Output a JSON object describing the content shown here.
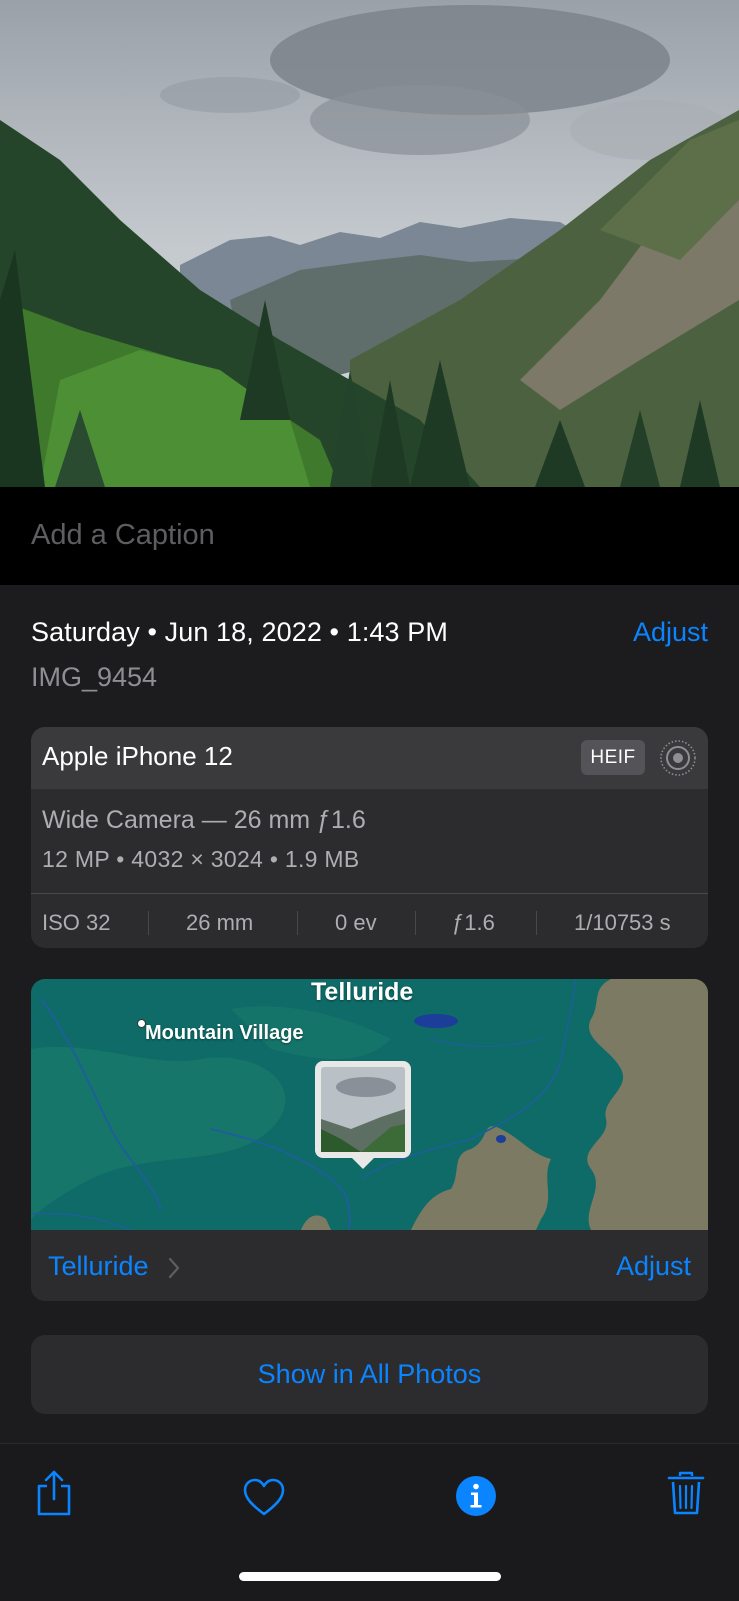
{
  "caption": {
    "placeholder": "Add a Caption"
  },
  "info": {
    "date_line": "Saturday • Jun 18, 2022 • 1:43 PM",
    "adjust_label": "Adjust",
    "filename": "IMG_9454"
  },
  "camera": {
    "device": "Apple iPhone 12",
    "format_badge": "HEIF",
    "lens": "Wide Camera — 26 mm ƒ1.6",
    "specs": "12 MP  •  4032 × 3024  •  1.9 MB",
    "exif": {
      "iso": "ISO 32",
      "focal_length": "26 mm",
      "exposure_bias": "0 ev",
      "aperture": "ƒ1.6",
      "shutter": "1/10753 s"
    }
  },
  "map": {
    "city_label": "Telluride",
    "town_label": "Mountain Village",
    "place_link": "Telluride",
    "adjust_label": "Adjust"
  },
  "actions": {
    "show_all": "Show in All Photos"
  },
  "toolbar": {
    "icons": [
      "share-icon",
      "heart-icon",
      "info-icon",
      "trash-icon"
    ]
  },
  "colors": {
    "accent": "#0a84ff",
    "background": "#1c1c1e",
    "card": "#2c2c2e"
  }
}
